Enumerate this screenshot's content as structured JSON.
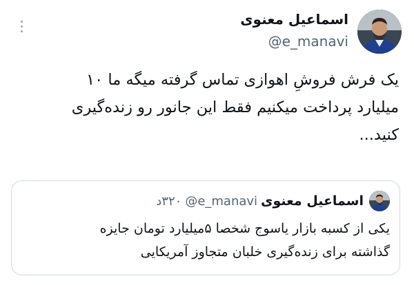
{
  "tweet": {
    "author_name": "اسماعیل معنوی",
    "author_handle": "@e_manavi",
    "lines": [
      "یک فرش فروشِ اهوازی تماس گرفته میگه ما ۱۰",
      "میلیارد پرداخت میکنیم فقط این جانور رو زنده‌گیری",
      "کنید..."
    ]
  },
  "quoted": {
    "author_name": "اسماعیل معنوی",
    "author_handle": "@e_manavi",
    "time": "۳۲۰د",
    "lines": [
      "یکی از کسبه بازار یاسوج شخصا ۵میلیارد تومان جایزه",
      "گذاشته برای زنده‌گیری خلبان متجاوز آمریکایی"
    ]
  },
  "icons": {
    "more": "more-vertical-icon",
    "avatar": "user-avatar"
  },
  "colors": {
    "text": "#0f1419",
    "secondary": "#536471",
    "border": "#cfd9de"
  }
}
